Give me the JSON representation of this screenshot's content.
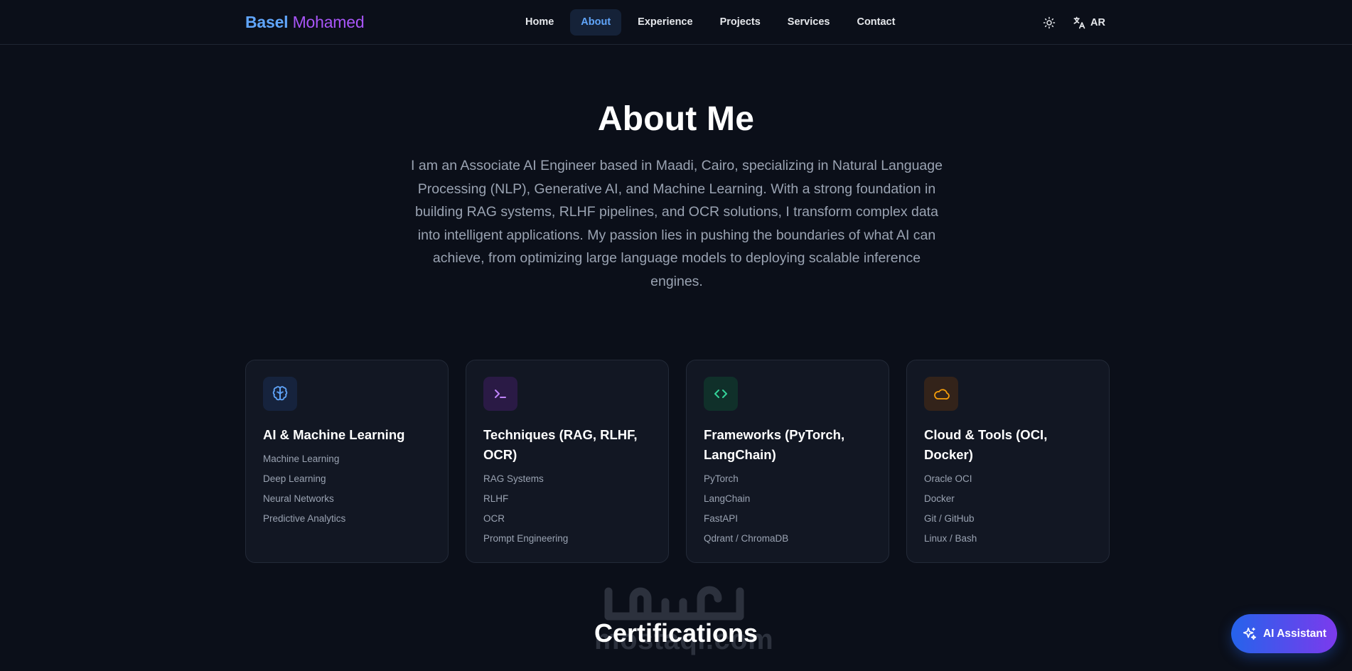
{
  "brand": {
    "first": "Basel",
    "last": "Mohamed"
  },
  "nav": {
    "items": [
      {
        "label": "Home",
        "active": false
      },
      {
        "label": "About",
        "active": true
      },
      {
        "label": "Experience",
        "active": false
      },
      {
        "label": "Projects",
        "active": false
      },
      {
        "label": "Services",
        "active": false
      },
      {
        "label": "Contact",
        "active": false
      }
    ],
    "theme_icon": "sun-icon",
    "lang_icon": "translate-icon",
    "lang_label": "AR"
  },
  "about": {
    "title": "About Me",
    "text": "I am an Associate AI Engineer based in Maadi, Cairo, specializing in Natural Language Processing (NLP), Generative AI, and Machine Learning. With a strong foundation in building RAG systems, RLHF pipelines, and OCR solutions, I transform complex data into intelligent applications. My passion lies in pushing the boundaries of what AI can achieve, from optimizing large language models to deploying scalable inference engines."
  },
  "cards": [
    {
      "icon": "brain-icon",
      "icon_color": "#60a5fa",
      "icon_bg": "#16233d",
      "title": "AI & Machine Learning",
      "items": [
        "Machine Learning",
        "Deep Learning",
        "Neural Networks",
        "Predictive Analytics"
      ]
    },
    {
      "icon": "terminal-icon",
      "icon_color": "#c084fc",
      "icon_bg": "#2a1a45",
      "title": "Techniques (RAG, RLHF, OCR)",
      "items": [
        "RAG Systems",
        "RLHF",
        "OCR",
        "Prompt Engineering"
      ]
    },
    {
      "icon": "code-icon",
      "icon_color": "#34d399",
      "icon_bg": "#10302a",
      "title": "Frameworks (PyTorch, LangChain)",
      "items": [
        "PyTorch",
        "LangChain",
        "FastAPI",
        "Qdrant / ChromaDB"
      ]
    },
    {
      "icon": "cloud-icon",
      "icon_color": "#f59e0b",
      "icon_bg": "#33231a",
      "title": "Cloud & Tools (OCI, Docker)",
      "items": [
        "Oracle OCI",
        "Docker",
        "Git / GitHub",
        "Linux / Bash"
      ]
    }
  ],
  "certifications": {
    "title": "Certifications"
  },
  "watermark": {
    "latin": "mostaql.com",
    "arabic": "مستقل"
  },
  "ai_assistant": {
    "icon": "sparkles-icon",
    "label": "AI Assistant"
  },
  "colors": {
    "background": "#0b0f19",
    "accent_blue": "#60a5fa",
    "accent_purple": "#a855f7",
    "card_bg": "#121723"
  }
}
